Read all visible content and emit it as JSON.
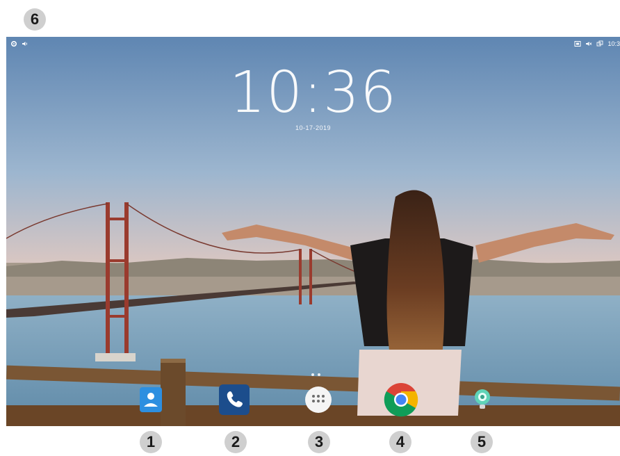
{
  "callouts": {
    "marker_6": "6",
    "marker_1": "1",
    "marker_2": "2",
    "marker_3": "3",
    "marker_4": "4",
    "marker_5": "5"
  },
  "status_bar": {
    "time": "10:3",
    "left_icons": [
      "settings-icon",
      "volume-icon"
    ],
    "right_icons": [
      "screen-icon",
      "mute-icon",
      "network-icon"
    ]
  },
  "lock_clock": {
    "time": "10:36",
    "date": "10-17-2019"
  },
  "home_pages": {
    "count": 2
  },
  "dock": {
    "apps": [
      "contacts-app",
      "phone-app",
      "app-drawer",
      "chrome-browser",
      "camera-app"
    ]
  },
  "colors": {
    "contacts": "#2d8fe0",
    "phone": "#1c4d8c",
    "drawer": "#f5f5f5",
    "marker": "#cfcfcf"
  }
}
